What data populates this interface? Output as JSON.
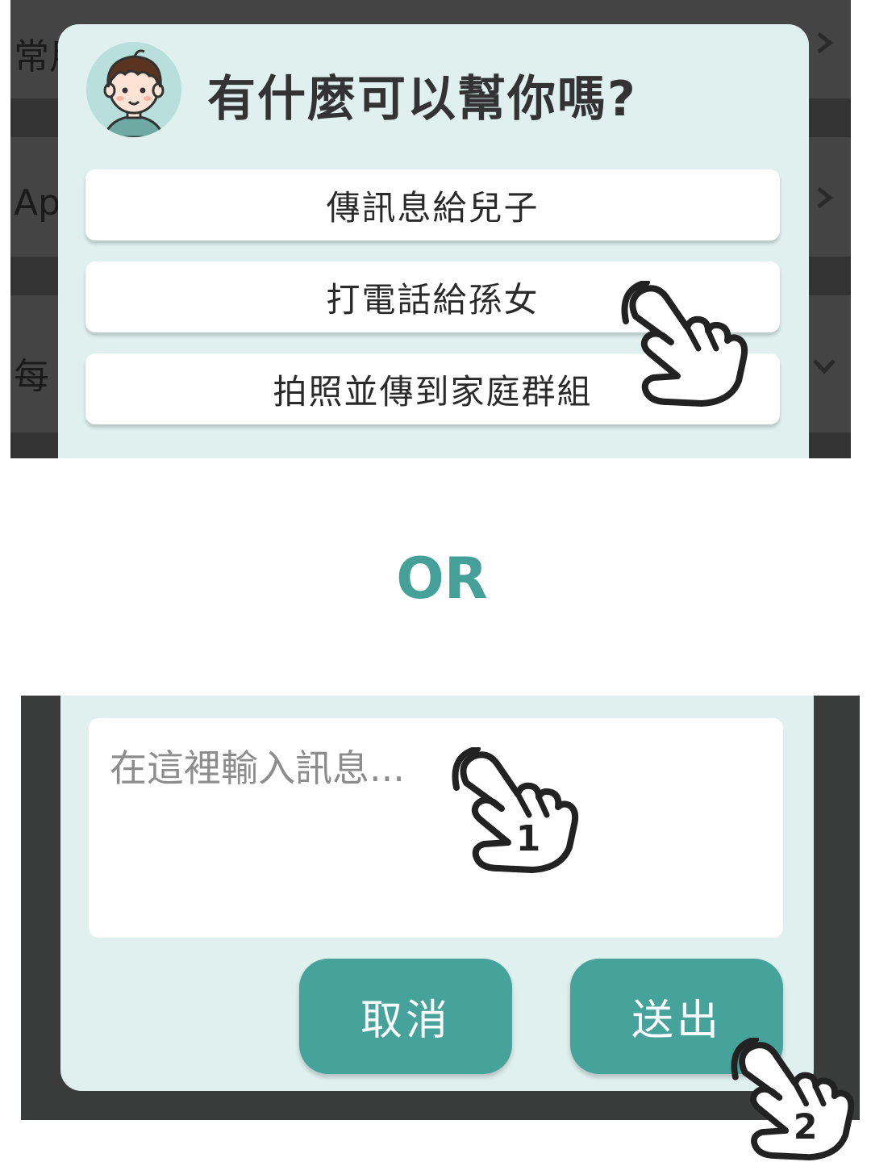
{
  "background_list": {
    "rows": [
      {
        "label": "常用",
        "chevron": "chevron-right-icon"
      },
      {
        "label": "Ap",
        "chevron": "chevron-right-icon"
      },
      {
        "label": "每",
        "chevron": "chevron-down-icon"
      }
    ]
  },
  "help_dialog": {
    "avatar": "boy-avatar-icon",
    "title": "有什麼可以幫你嗎?",
    "options": [
      {
        "label": "傳訊息給兒子"
      },
      {
        "label": "打電話給孫女"
      },
      {
        "label": "拍照並傳到家庭群組"
      }
    ]
  },
  "separator": {
    "label": "OR"
  },
  "compose_dialog": {
    "input_placeholder": "在這裡輸入訊息...",
    "cancel_label": "取消",
    "send_label": "送出"
  },
  "gestures": {
    "step_1": "1",
    "step_2": "2",
    "icon": "tap-hand-icon"
  },
  "colors": {
    "accent": "#45a39b",
    "dialog_bg": "#dff0ef",
    "backdrop": "#3a3a3a"
  }
}
